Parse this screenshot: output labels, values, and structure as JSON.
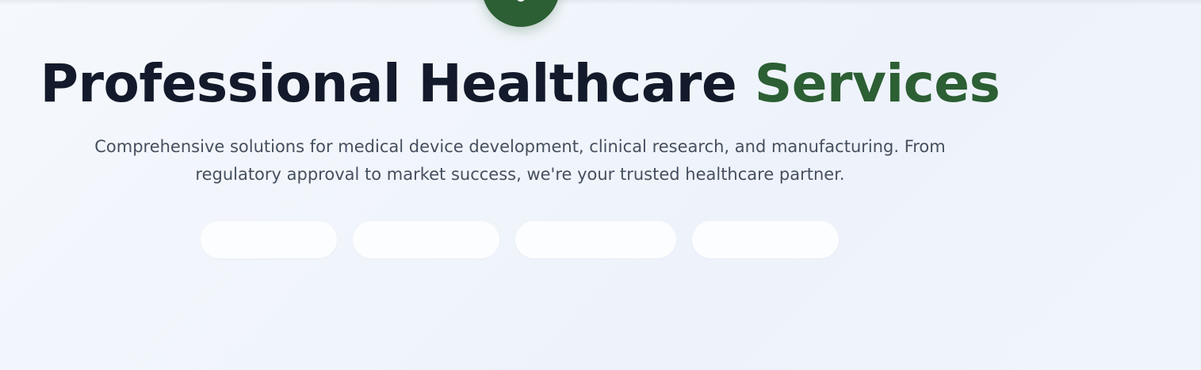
{
  "hero": {
    "icon": "gear-icon",
    "title_main": "Professional Healthcare ",
    "title_accent": "Services",
    "subtitle": "Comprehensive solutions for medical device development, clinical research, and manufacturing. From regulatory approval to market success, we're your trusted healthcare partner."
  },
  "colors": {
    "accent": "#2c5f34",
    "title": "#131a2b",
    "subtitle": "#454f5e",
    "background": "#f3f6fb"
  }
}
